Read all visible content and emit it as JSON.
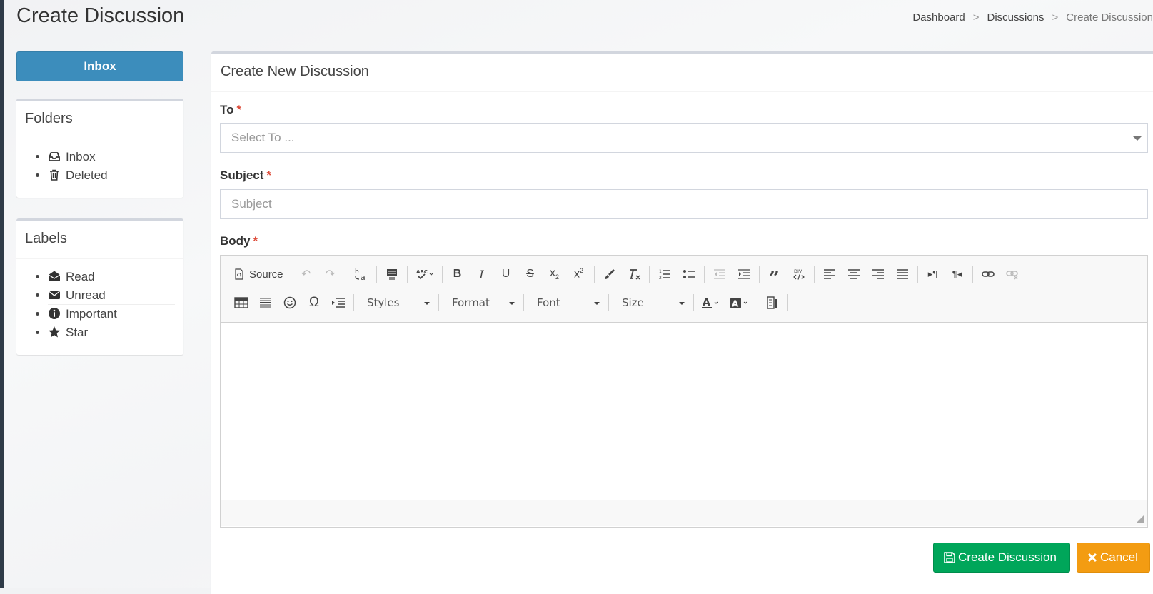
{
  "page": {
    "title": "Create Discussion"
  },
  "breadcrumb": {
    "items": [
      "Dashboard",
      "Discussions"
    ],
    "current": "Create Discussion"
  },
  "sidebar": {
    "inbox_button": "Inbox",
    "folders": {
      "title": "Folders",
      "items": [
        {
          "label": "Inbox",
          "icon": "inbox-icon"
        },
        {
          "label": "Deleted",
          "icon": "trash-icon"
        }
      ]
    },
    "labels": {
      "title": "Labels",
      "items": [
        {
          "label": "Read",
          "icon": "envelope-open-icon"
        },
        {
          "label": "Unread",
          "icon": "envelope-icon"
        },
        {
          "label": "Important",
          "icon": "info-circle-icon"
        },
        {
          "label": "Star",
          "icon": "star-icon"
        }
      ]
    }
  },
  "form": {
    "header": "Create New Discussion",
    "to": {
      "label": "To",
      "required": "*",
      "placeholder": "Select To ..."
    },
    "subject": {
      "label": "Subject",
      "required": "*",
      "placeholder": "Subject"
    },
    "body": {
      "label": "Body",
      "required": "*"
    },
    "editor": {
      "source_label": "Source",
      "styles_label": "Styles",
      "format_label": "Format",
      "font_label": "Font",
      "size_label": "Size"
    },
    "create_button": "Create Discussion",
    "cancel_button": "Cancel"
  },
  "colors": {
    "primary": "#3c8dbc",
    "success": "#00a65a",
    "warning": "#f39c12",
    "required": "#dd4b39"
  }
}
